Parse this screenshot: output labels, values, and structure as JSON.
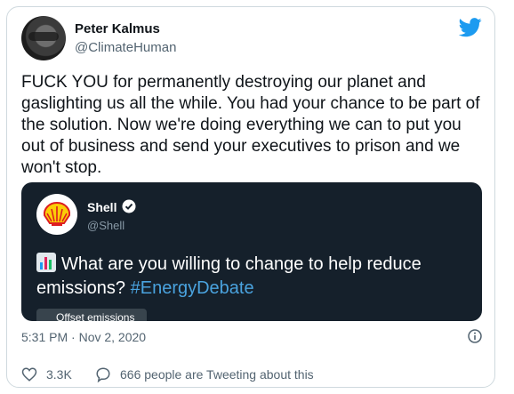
{
  "author": {
    "name": "Peter Kalmus",
    "handle": "@ClimateHuman"
  },
  "tweet": {
    "text": "FUCK YOU for permanently destroying our planet and gaslighting us all the while. You had your chance to be part of the solution. Now we're doing everything we can to put you out of business and send your executives to prison and we won't stop.",
    "timestamp": "5:31 PM · Nov 2, 2020"
  },
  "quoted": {
    "name": "Shell",
    "handle": "@Shell",
    "text": "What are you willing to change to help reduce emissions?",
    "hashtag": "#EnergyDebate",
    "offer_label": "Offset emissions"
  },
  "actions": {
    "likes": "3.3K",
    "conversation": "666 people are Tweeting about this"
  },
  "colors": {
    "twitter_blue": "#1d9bf0",
    "like_red": "#e0245e",
    "quote_bg": "#15202b"
  },
  "icons": [
    "twitter-bird-icon",
    "verified-badge-icon",
    "chart-emoji-icon",
    "info-icon",
    "heart-icon",
    "speech-bubble-icon",
    "shell-logo"
  ]
}
